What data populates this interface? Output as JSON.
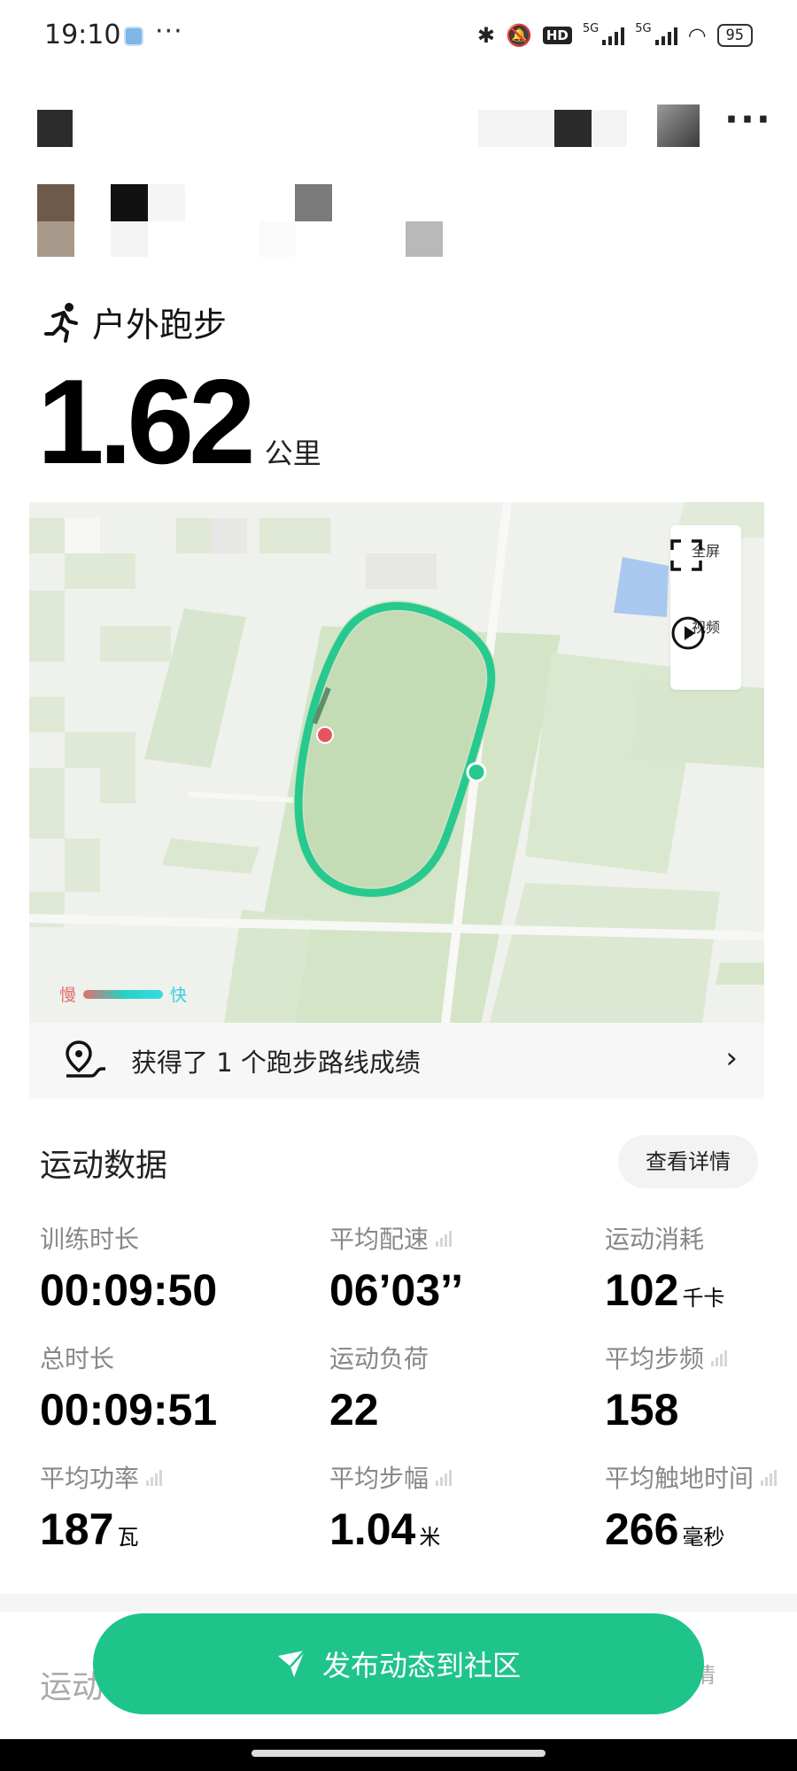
{
  "status_bar": {
    "time": "19:10",
    "more": "···",
    "hd": "HD",
    "net1": "5G",
    "net2": "5G",
    "battery": "95"
  },
  "header": {
    "more": "···"
  },
  "activity": {
    "type": "户外跑步",
    "distance": "1.62",
    "distance_unit": "公里"
  },
  "map": {
    "fullscreen_label": "全屏",
    "video_label": "视频",
    "legend_slow": "慢",
    "legend_fast": "快"
  },
  "route_banner": {
    "text": "获得了 1 个跑步路线成绩"
  },
  "stats_section": {
    "title": "运动数据",
    "detail_button": "查看详情",
    "items": [
      {
        "label": "训练时长",
        "value": "00:09:50",
        "unit": ""
      },
      {
        "label": "平均配速",
        "value": "06’03’’",
        "unit": ""
      },
      {
        "label": "运动消耗",
        "value": "102",
        "unit": "千卡"
      },
      {
        "label": "总时长",
        "value": "00:09:51",
        "unit": ""
      },
      {
        "label": "运动负荷",
        "value": "22",
        "unit": ""
      },
      {
        "label": "平均步频",
        "value": "158",
        "unit": ""
      },
      {
        "label": "平均功率",
        "value": "187",
        "unit": "瓦"
      },
      {
        "label": "平均步幅",
        "value": "1.04",
        "unit": "米"
      },
      {
        "label": "平均触地时间",
        "value": "266",
        "unit": "毫秒"
      }
    ]
  },
  "section2": {
    "title_partial": "运动",
    "detail_partial": "详情"
  },
  "publish_button": {
    "label": "发布动态到社区"
  },
  "colors": {
    "accent": "#1fc48a",
    "route": "#27c98f"
  }
}
